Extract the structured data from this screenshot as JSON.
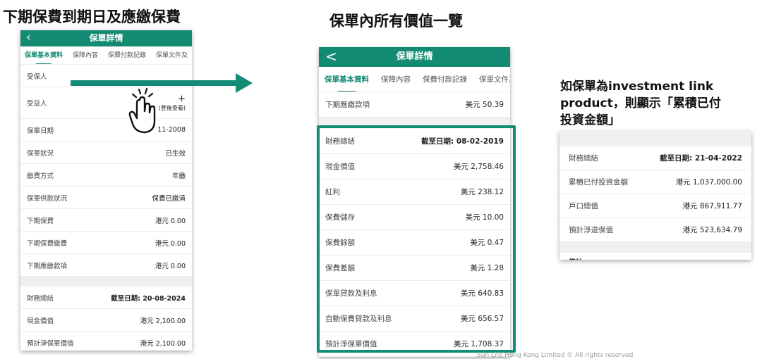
{
  "headings": {
    "left": "下期保費到期日及應繳保費",
    "middle": "保單內所有價值一覽",
    "right_line1": "如保單為investment link",
    "right_line2": "product，則顯示「累積已付",
    "right_line3": "投資金額」"
  },
  "left_phone": {
    "title": "保單詳情",
    "back": "‹",
    "tabs": [
      "保單基本資料",
      "保障內容",
      "保費付款記錄",
      "保單文件及"
    ],
    "rows": [
      {
        "label": "受保人",
        "value": ""
      },
      {
        "label": "受益人",
        "value": "(登後查看)",
        "extra": "+"
      },
      {
        "label": "保單日期",
        "value": "11-2008"
      },
      {
        "label": "保單狀況",
        "value": "已生效"
      },
      {
        "label": "繳費方式",
        "value": "年繳"
      },
      {
        "label": "保單供款狀況",
        "value": "保費已繳清"
      },
      {
        "label": "下期保費",
        "value": "港元 0.00"
      },
      {
        "label": "下期保費繳費",
        "value": "港元 0.00"
      },
      {
        "label": "下期應繳款項",
        "value": "港元 0.00"
      }
    ],
    "fin_rows": [
      {
        "label": "財務總結",
        "value": "截至日期: 20-08-2024"
      },
      {
        "label": "現金價值",
        "value": "港元 2,100.00"
      },
      {
        "label": "預計淨保單價值",
        "value": "港元 2,100.00"
      }
    ]
  },
  "middle_phone": {
    "title": "保單詳情",
    "back": "<",
    "tabs": [
      "保單基本資料",
      "保障內容",
      "保費付款記錄",
      "保單文件及"
    ],
    "top_row": {
      "label": "下期應繳款項",
      "value": "美元 50.39"
    },
    "fin_rows": [
      {
        "label": "財務總結",
        "value": "截至日期: 08-02-2019"
      },
      {
        "label": "現金價值",
        "value": "美元 2,758.46"
      },
      {
        "label": "紅利",
        "value": "美元 238.12"
      },
      {
        "label": "保費儲存",
        "value": "美元 10.00"
      },
      {
        "label": "保費餘額",
        "value": "美元 0.47"
      },
      {
        "label": "保費差額",
        "value": "美元 1.28"
      },
      {
        "label": "保單貸款及利息",
        "value": "美元 640.83"
      },
      {
        "label": "自動保費貸款及利息",
        "value": "美元 656.57"
      },
      {
        "label": "預計淨保單價值",
        "value": "美元 1,708.37"
      }
    ]
  },
  "right_phone": {
    "rows": [
      {
        "label": "財務總結",
        "value": "截至日期: 21-04-2022"
      },
      {
        "label": "累積已付投資金額",
        "value": "港元 1,037,000.00"
      },
      {
        "label": "戶口總值",
        "value": "港元 867,911.77"
      },
      {
        "label": "預計淨退保值",
        "value": "港元 523,634.79"
      }
    ],
    "cut_label": "備註："
  },
  "footer": "Sun Life Hong Kong Limited © All rights reserved",
  "colors": {
    "brand": "#138a72",
    "highlight": "#128c76"
  }
}
